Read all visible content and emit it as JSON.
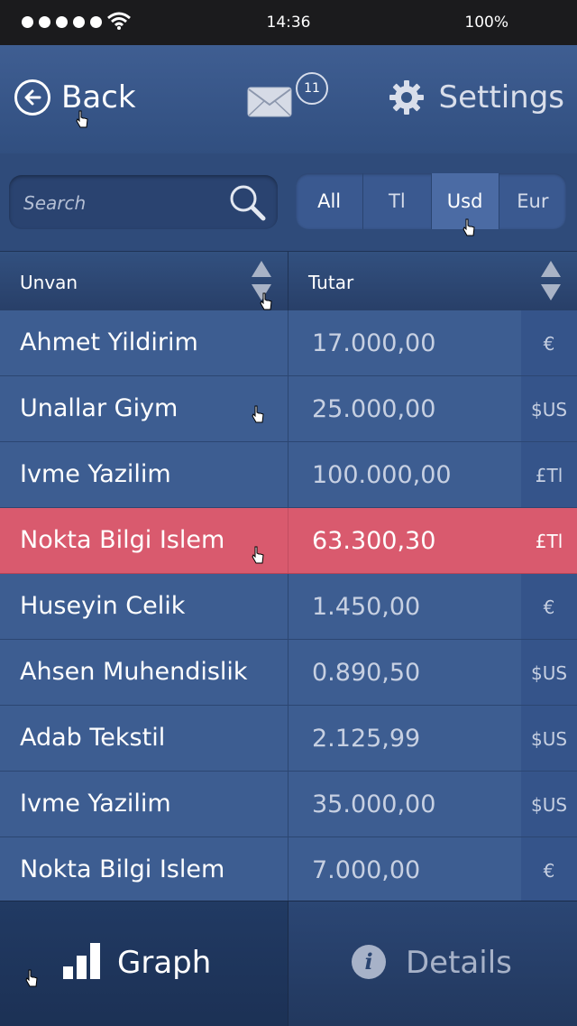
{
  "status_bar": {
    "time": "14:36",
    "battery": "100%",
    "signal_icon": "signal-dots-icon",
    "wifi_icon": "wifi-icon"
  },
  "header": {
    "back_label": "Back",
    "mail_badge": "11",
    "settings_label": "Settings"
  },
  "search": {
    "placeholder": "Search"
  },
  "currency_filter": {
    "options": [
      "All",
      "Tl",
      "Usd",
      "Eur"
    ],
    "selected": "Usd"
  },
  "columns": {
    "col1": "Unvan",
    "col2": "Tutar"
  },
  "rows": [
    {
      "name": "Ahmet Yildirim",
      "amount": "17.000,00",
      "currency": "€"
    },
    {
      "name": "Unallar Giym",
      "amount": "25.000,00",
      "currency": "$US"
    },
    {
      "name": "Ivme Yazilim",
      "amount": "100.000,00",
      "currency": "£Tl"
    },
    {
      "name": "Nokta Bilgi Islem",
      "amount": "63.300,30",
      "currency": "£Tl"
    },
    {
      "name": "Huseyin Celik",
      "amount": "1.450,00",
      "currency": "€"
    },
    {
      "name": "Ahsen Muhendislik",
      "amount": "0.890,50",
      "currency": "$US"
    },
    {
      "name": "Adab Tekstil",
      "amount": "2.125,99",
      "currency": "$US"
    },
    {
      "name": "Ivme Yazilim",
      "amount": "35.000,00",
      "currency": "$US"
    },
    {
      "name": "Nokta Bilgi Islem",
      "amount": "7.000,00",
      "currency": "€"
    }
  ],
  "highlighted_row": 3,
  "tabs": {
    "graph": "Graph",
    "details": "Details"
  },
  "colors": {
    "background": "#3d5d91",
    "highlight": "#d95a6e",
    "status_bar": "#1b1b1d"
  }
}
